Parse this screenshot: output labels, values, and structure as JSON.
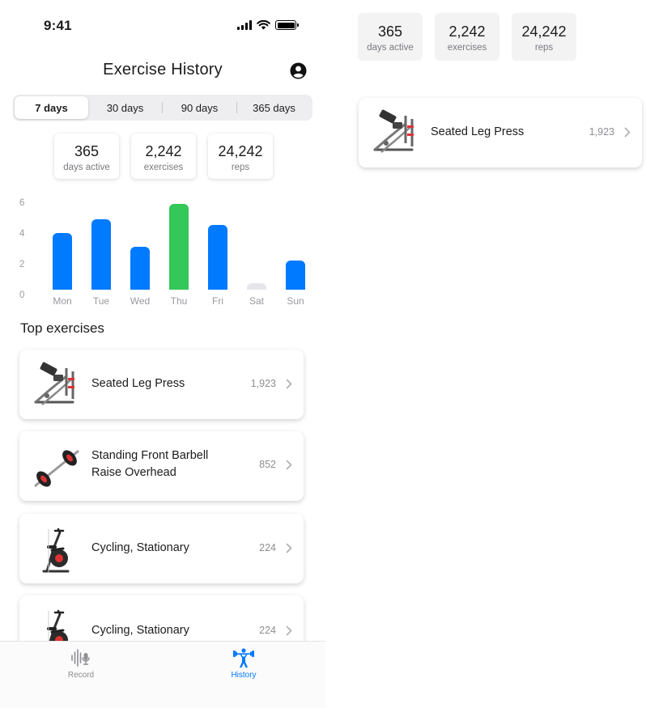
{
  "status_bar": {
    "time": "9:41"
  },
  "header": {
    "title": "Exercise History"
  },
  "range_tabs": [
    {
      "label": "7 days",
      "active": true
    },
    {
      "label": "30 days",
      "active": false
    },
    {
      "label": "90 days",
      "active": false
    },
    {
      "label": "365 days",
      "active": false
    }
  ],
  "stats": [
    {
      "value": "365",
      "label": "days active"
    },
    {
      "value": "2,242",
      "label": "exercises"
    },
    {
      "value": "24,242",
      "label": "reps"
    }
  ],
  "chart_data": {
    "type": "bar",
    "categories": [
      "Mon",
      "Tue",
      "Wed",
      "Thu",
      "Fri",
      "Sat",
      "Sun"
    ],
    "values": [
      3.7,
      4.6,
      2.8,
      5.6,
      4.2,
      0.0,
      1.9
    ],
    "highlight_color": "#34c759",
    "bar_color": "#007aff",
    "empty_color": "#e5e5ea",
    "highlight_index": 3,
    "y_ticks": [
      "0",
      "2",
      "4",
      "6"
    ],
    "ylim": [
      0,
      6
    ]
  },
  "section": {
    "title": "Top exercises"
  },
  "exercises": [
    {
      "name": "Seated Leg Press",
      "count": "1,923",
      "icon": "leg-press-machine-icon"
    },
    {
      "name": "Standing Front Barbell Raise Overhead",
      "count": "852",
      "icon": "barbell-icon"
    },
    {
      "name": "Cycling, Stationary",
      "count": "224",
      "icon": "stationary-bike-icon"
    },
    {
      "name": "Cycling, Stationary",
      "count": "224",
      "icon": "stationary-bike-icon"
    }
  ],
  "tabbar": {
    "record_label": "Record",
    "history_label": "History",
    "active_color": "#007aff",
    "inactive_color": "#8e8e93"
  },
  "component_preview": {
    "stats": [
      {
        "value": "365",
        "label": "days active"
      },
      {
        "value": "2,242",
        "label": "exercises"
      },
      {
        "value": "24,242",
        "label": "reps"
      }
    ],
    "exercise": {
      "name": "Seated Leg Press",
      "count": "1,923"
    }
  }
}
